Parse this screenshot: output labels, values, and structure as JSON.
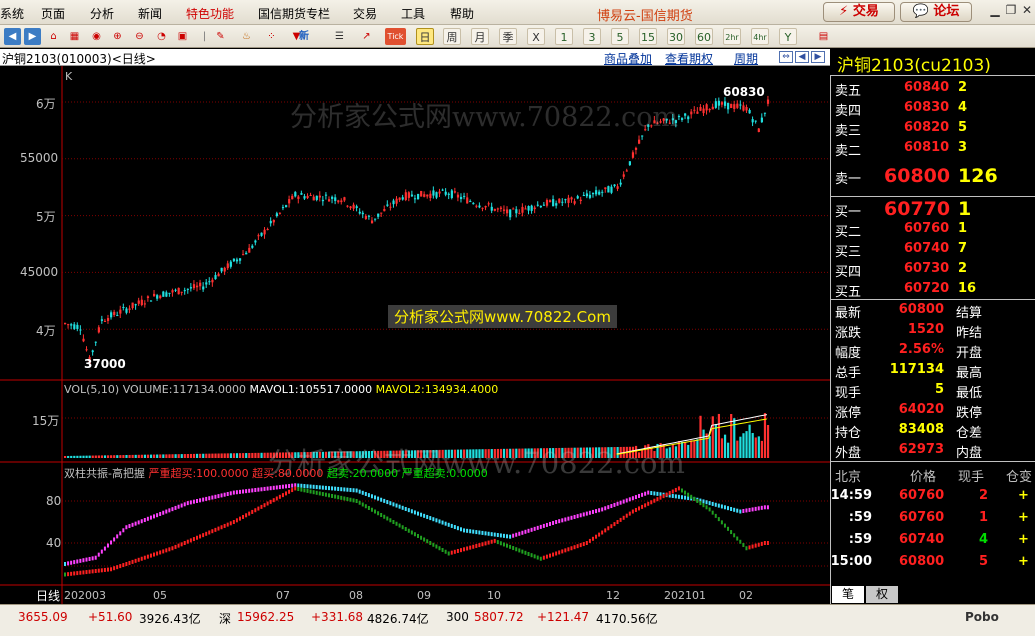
{
  "menu": {
    "items": [
      "系统",
      "页面",
      "分析",
      "新闻",
      "特色功能",
      "国信期货专栏",
      "交易",
      "工具",
      "帮助"
    ],
    "brand": "博易云-国信期货",
    "trade": "交易",
    "forum": "论坛"
  },
  "toolbar": {
    "period_buttons": [
      "日",
      "周",
      "月",
      "季",
      "X",
      "1",
      "3",
      "5",
      "15",
      "30",
      "60",
      "2hr",
      "4hr",
      "Y"
    ],
    "new_label": "新",
    "tick_label": "Tick"
  },
  "chart_header": {
    "title": "沪铜2103(010003)<日线>",
    "links": [
      "商品叠加",
      "查看期权",
      "周期"
    ]
  },
  "main_chart": {
    "k_label": "K",
    "y_ticks": [
      "6万",
      "55000",
      "5万",
      "45000",
      "4万"
    ],
    "high_label": "60830",
    "low_label": "37000",
    "watermark": "分析家公式网www.70822.com",
    "watermark_box": "分析家公式网www.70822.Com"
  },
  "volume_panel": {
    "legend": {
      "vol": "VOL(5,10) VOLUME:117134.0000",
      "mavol1": "MAVOL1:105517.0000",
      "mavol2": "MAVOL2:134934.4000"
    },
    "y_ticks": [
      "15万"
    ],
    "watermark": "分析家公式网www.70822.com"
  },
  "indicator_panel": {
    "title": "双柱共振-高把握",
    "params": [
      "严重超买:100.0000",
      "超买:80.0000",
      "超卖:20.0000",
      "严重超卖:0.0000"
    ],
    "y_ticks": [
      "80",
      "40"
    ]
  },
  "x_axis": {
    "label": "日线",
    "ticks": [
      "202003",
      "05",
      "07",
      "08",
      "09",
      "10",
      "12",
      "202101",
      "02"
    ]
  },
  "quote": {
    "symbol": "沪铜2103(cu2103)",
    "asks": [
      {
        "label": "卖五",
        "price": "60840",
        "vol": "2"
      },
      {
        "label": "卖四",
        "price": "60830",
        "vol": "4"
      },
      {
        "label": "卖三",
        "price": "60820",
        "vol": "5"
      },
      {
        "label": "卖二",
        "price": "60810",
        "vol": "3"
      },
      {
        "label": "卖一",
        "price": "60800",
        "vol": "126"
      }
    ],
    "bids": [
      {
        "label": "买一",
        "price": "60770",
        "vol": "1"
      },
      {
        "label": "买二",
        "price": "60760",
        "vol": "1"
      },
      {
        "label": "买三",
        "price": "60740",
        "vol": "7"
      },
      {
        "label": "买四",
        "price": "60730",
        "vol": "2"
      },
      {
        "label": "买五",
        "price": "60720",
        "vol": "16"
      }
    ],
    "stats": [
      {
        "label": "最新",
        "value": "60800",
        "label2": "结算",
        "color": "#ff2020"
      },
      {
        "label": "涨跌",
        "value": "1520",
        "label2": "昨结",
        "color": "#ff2020"
      },
      {
        "label": "幅度",
        "value": "2.56%",
        "label2": "开盘",
        "color": "#ff2020"
      },
      {
        "label": "总手",
        "value": "117134",
        "label2": "最高",
        "color": "#ffff00"
      },
      {
        "label": "现手",
        "value": "5",
        "label2": "最低",
        "color": "#ffff00"
      },
      {
        "label": "涨停",
        "value": "64020",
        "label2": "跌停",
        "color": "#ff2020"
      },
      {
        "label": "持仓",
        "value": "83408",
        "label2": "仓差",
        "color": "#ffff00"
      },
      {
        "label": "外盘",
        "value": "62973",
        "label2": "内盘",
        "color": "#ff2020"
      }
    ],
    "ticks_header": {
      "city": "北京",
      "price": "价格",
      "now": "现手",
      "pos": "仓变"
    },
    "ticks": [
      {
        "time": "14:59",
        "price": "60760",
        "vol": "2",
        "chg": "+",
        "vcolor": "#ff2020"
      },
      {
        "time": ":59",
        "price": "60760",
        "vol": "1",
        "chg": "+",
        "vcolor": "#ff2020"
      },
      {
        "time": ":59",
        "price": "60740",
        "vol": "4",
        "chg": "+",
        "vcolor": "#00dd00"
      },
      {
        "time": "15:00",
        "price": "60800",
        "vol": "5",
        "chg": "+",
        "vcolor": "#ff2020"
      }
    ],
    "tabs": [
      "笔",
      "权"
    ]
  },
  "statusbar": {
    "items": [
      {
        "text": "3655.09",
        "color": "#cc0000"
      },
      {
        "text": "+51.60",
        "color": "#cc0000"
      },
      {
        "text": "3926.43亿",
        "color": "#000000"
      },
      {
        "text": "深",
        "color": "#000000"
      },
      {
        "text": "15962.25",
        "color": "#cc0000"
      },
      {
        "text": "+331.68",
        "color": "#cc0000"
      },
      {
        "text": "4826.74亿",
        "color": "#000000"
      },
      {
        "text": "300",
        "color": "#000000"
      },
      {
        "text": "5807.72",
        "color": "#cc0000"
      },
      {
        "text": "+121.47",
        "color": "#cc0000"
      },
      {
        "text": "4170.56亿",
        "color": "#000000"
      }
    ],
    "brand": "Pobo"
  },
  "colors": {
    "up": "#ff3030",
    "down": "#20e0e0",
    "grid": "#800000",
    "ma1": "#ffffff",
    "ma2": "#ffff00"
  }
}
